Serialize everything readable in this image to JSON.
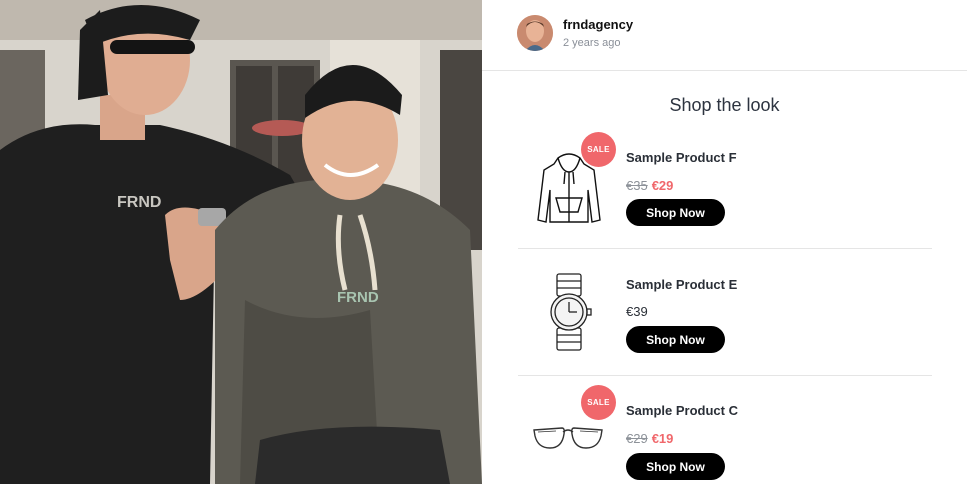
{
  "post": {
    "username": "frndagency",
    "timestamp": "2 years ago",
    "photo_print_left": "FRND",
    "photo_print_right": "FRND"
  },
  "shop": {
    "title": "Shop the look",
    "products": [
      {
        "name": "Sample Product F",
        "old_price": "€35",
        "price": "€29",
        "on_sale": true,
        "badge": "SALE",
        "button": "Shop Now",
        "icon": "hoodie-icon"
      },
      {
        "name": "Sample Product E",
        "price": "€39",
        "on_sale": false,
        "button": "Shop Now",
        "icon": "wristwatch-icon"
      },
      {
        "name": "Sample Product C",
        "old_price": "€29",
        "price": "€19",
        "on_sale": true,
        "badge": "SALE",
        "button": "Shop Now",
        "icon": "glasses-icon"
      }
    ]
  },
  "colors": {
    "sale": "#f0676b",
    "button": "#000000",
    "divider": "#e5e5e5"
  }
}
